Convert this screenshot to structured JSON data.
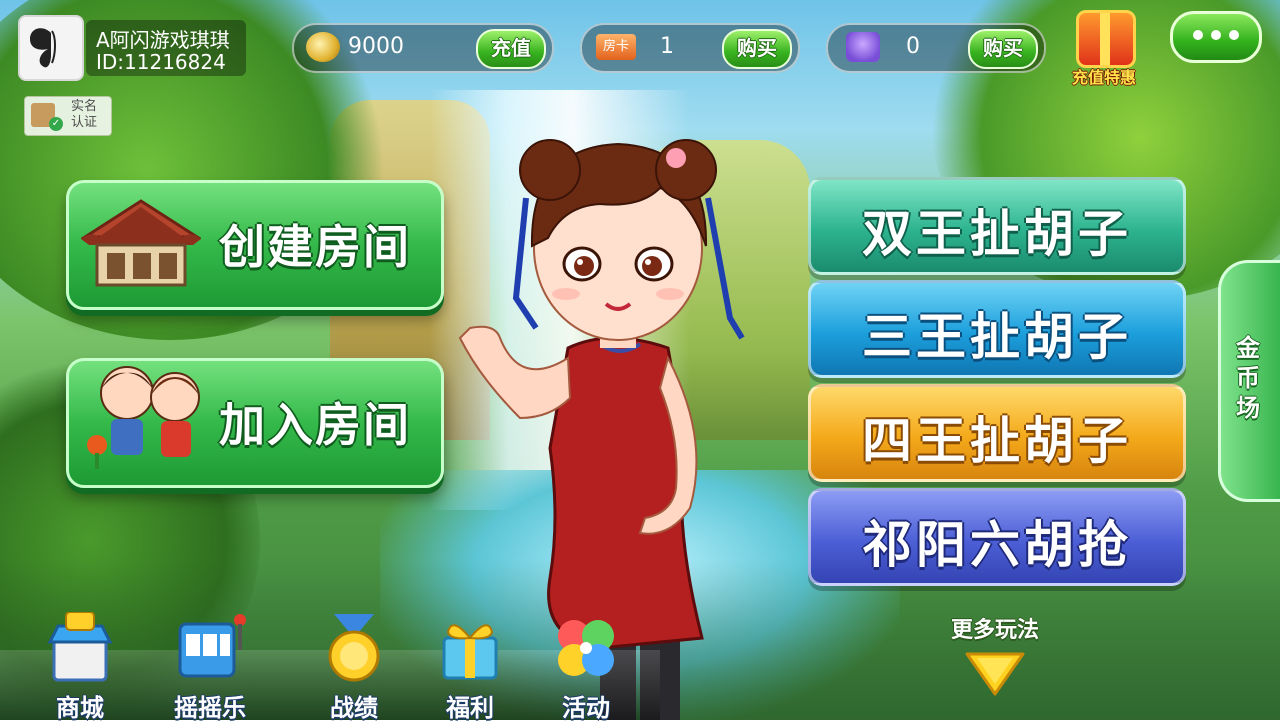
{
  "user": {
    "name": "A阿闪游戏琪琪",
    "id_label": "ID:11216824"
  },
  "verify": {
    "label": "实名认证"
  },
  "currency": [
    {
      "icon": "gold-coin-icon",
      "value": "9000",
      "button": "充值"
    },
    {
      "icon": "room-card-icon",
      "icon_text": "房卡",
      "value": "1",
      "button": "购买"
    },
    {
      "icon": "token-icon",
      "value": "0",
      "button": "购买"
    }
  ],
  "promo": {
    "label": "充值特惠"
  },
  "main_actions": {
    "create": "创建房间",
    "join": "加入房间"
  },
  "modes": [
    "双王扯胡子",
    "三王扯胡子",
    "四王扯胡子",
    "祁阳六胡抢"
  ],
  "more_modes": "更多玩法",
  "coin_field": "金币场",
  "bottom_nav": [
    "商城",
    "摇摇乐",
    "战绩",
    "福利",
    "活动"
  ],
  "colors": {
    "green": "#34b94a",
    "teal": "#2db38f",
    "blue": "#1c9fdc",
    "orange": "#f4a91a",
    "purple": "#4c5fd6"
  }
}
